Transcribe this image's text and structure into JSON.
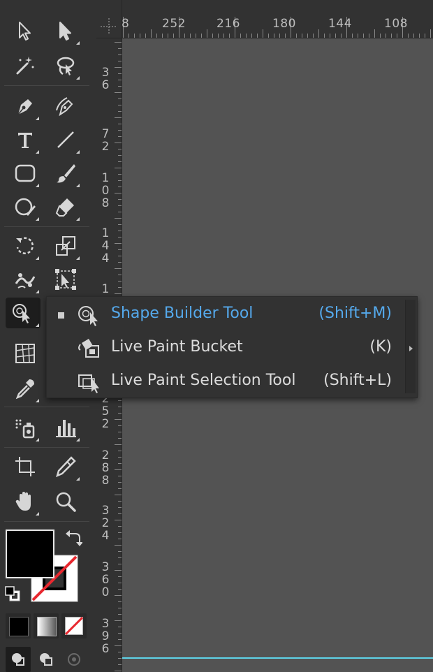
{
  "ruler": {
    "top_labels": [
      "8",
      "252",
      "216",
      "180",
      "144",
      "108"
    ],
    "left_labels": [
      [
        "3",
        "6"
      ],
      [
        "7",
        "2"
      ],
      [
        "1",
        "0",
        "8"
      ],
      [
        "1",
        "4",
        "4"
      ],
      [
        "1"
      ],
      [
        "2",
        "5",
        "2"
      ],
      [
        "2",
        "8",
        "8"
      ],
      [
        "3",
        "2",
        "4"
      ],
      [
        "3",
        "6",
        "0"
      ],
      [
        "3",
        "9",
        "6"
      ]
    ]
  },
  "tools": [
    {
      "name": "selection-tool",
      "icon": "selection-arrow-icon"
    },
    {
      "name": "direct-selection-tool",
      "icon": "direct-selection-arrow-icon"
    },
    {
      "name": "magic-wand-tool",
      "icon": "magic-wand-icon"
    },
    {
      "name": "lasso-tool",
      "icon": "lasso-icon"
    },
    {
      "name": "pen-tool",
      "icon": "pen-icon"
    },
    {
      "name": "curvature-tool",
      "icon": "curvature-pen-icon"
    },
    {
      "name": "type-tool",
      "icon": "type-icon"
    },
    {
      "name": "line-segment-tool",
      "icon": "line-segment-icon"
    },
    {
      "name": "rectangle-tool",
      "icon": "rounded-rectangle-icon"
    },
    {
      "name": "paintbrush-tool",
      "icon": "paintbrush-icon"
    },
    {
      "name": "shaper-tool",
      "icon": "shaper-icon"
    },
    {
      "name": "eraser-tool",
      "icon": "eraser-icon"
    },
    {
      "name": "rotate-tool",
      "icon": "rotate-icon"
    },
    {
      "name": "scale-tool",
      "icon": "scale-icon"
    },
    {
      "name": "puppet-warp-tool",
      "icon": "puppet-warp-icon"
    },
    {
      "name": "free-transform-tool",
      "icon": "free-transform-icon"
    },
    {
      "name": "shape-builder-tool",
      "icon": "shape-builder-icon"
    },
    {
      "name": "perspective-grid-tool",
      "icon": "perspective-grid-icon"
    },
    {
      "name": "mesh-tool",
      "icon": "mesh-icon"
    },
    {
      "name": "eyedropper-tool",
      "icon": "eyedropper-icon"
    },
    {
      "name": "symbol-sprayer-tool",
      "icon": "symbol-sprayer-icon"
    },
    {
      "name": "column-graph-tool",
      "icon": "column-graph-icon"
    },
    {
      "name": "artboard-tool",
      "icon": "artboard-icon"
    },
    {
      "name": "slice-tool",
      "icon": "slice-icon"
    },
    {
      "name": "hand-tool",
      "icon": "hand-icon"
    },
    {
      "name": "zoom-tool",
      "icon": "zoom-icon"
    }
  ],
  "flyout": {
    "items": [
      {
        "label": "Shape Builder Tool",
        "shortcut": "(Shift+M)",
        "icon": "shape-builder-icon",
        "selected": true
      },
      {
        "label": "Live Paint Bucket",
        "shortcut": "(K)",
        "icon": "live-paint-bucket-icon",
        "selected": false
      },
      {
        "label": "Live Paint Selection Tool",
        "shortcut": "(Shift+L)",
        "icon": "live-paint-selection-icon",
        "selected": false
      }
    ]
  },
  "colors": {
    "fill": "#000000",
    "stroke": "none",
    "accent": "#55a9ec",
    "guide_line": "#5fd3e8"
  }
}
